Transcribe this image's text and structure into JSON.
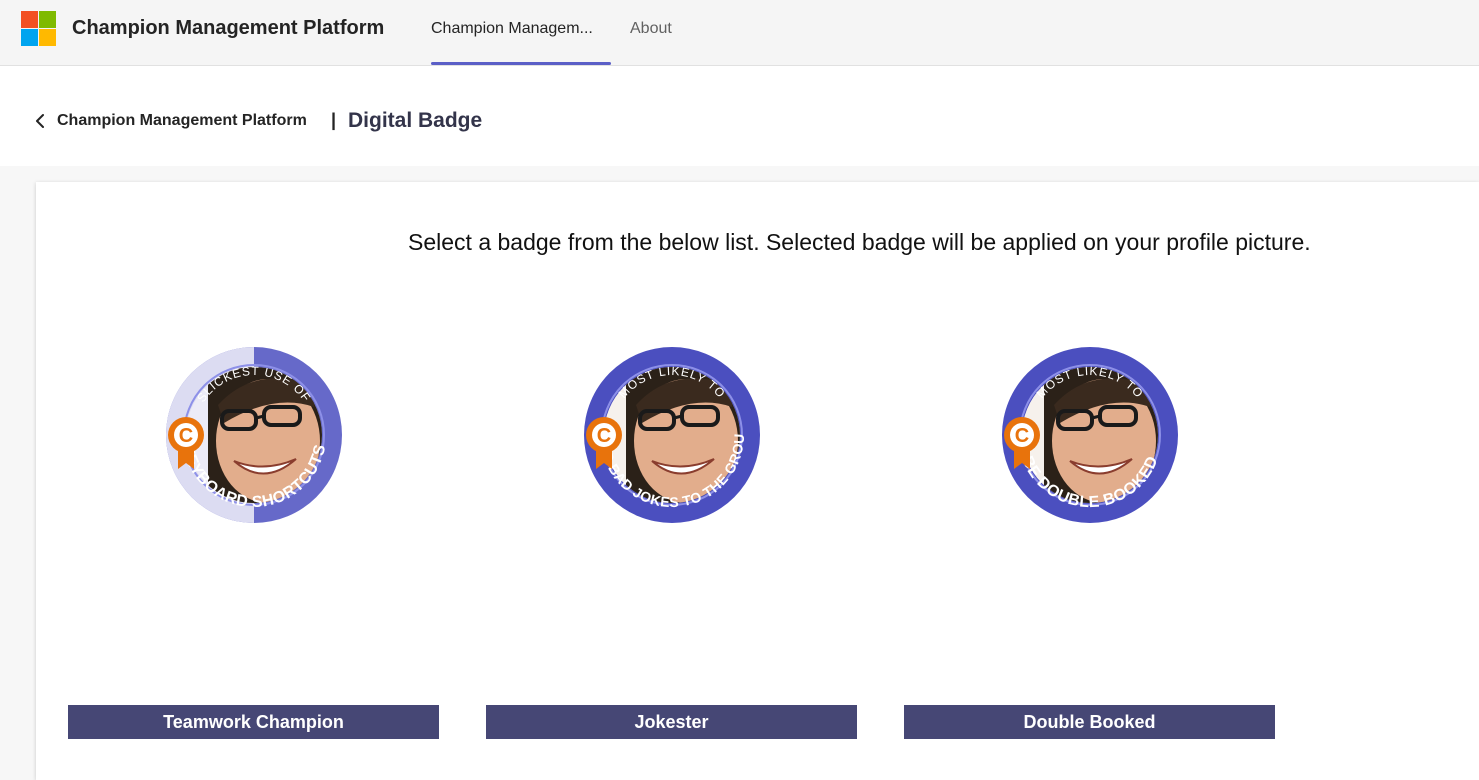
{
  "app": {
    "title": "Champion Management Platform",
    "logo_colors": [
      "#f25022",
      "#7fba00",
      "#00a4ef",
      "#ffb900"
    ]
  },
  "tabs": [
    {
      "label": "Champion Managem...",
      "active": true
    },
    {
      "label": "About",
      "active": false
    }
  ],
  "breadcrumb": {
    "back_icon": "chevron-left-icon",
    "parent": "Champion Management Platform",
    "separator": "|",
    "current": "Digital Badge"
  },
  "main": {
    "instructions": "Select a badge from the below list. Selected badge will be applied on your profile picture."
  },
  "badges": [
    {
      "name": "Teamwork Champion",
      "ring_top": "SLICKEST USE OF",
      "ring_bottom": "KEYBOARD SHORTCUTS"
    },
    {
      "name": "Jokester",
      "ring_top": "MOST LIKELY TO",
      "ring_bottom": "SEND BAD JOKES TO THE GROUP"
    },
    {
      "name": "Double Booked",
      "ring_top": "MOST LIKELY TO",
      "ring_bottom": "BE DOUBLE BOOKED"
    }
  ],
  "colors": {
    "accent": "#5b5fc7",
    "button_bg": "#464775",
    "badge_ring": "#4b4fbf",
    "champion_icon": "#e8730c"
  }
}
